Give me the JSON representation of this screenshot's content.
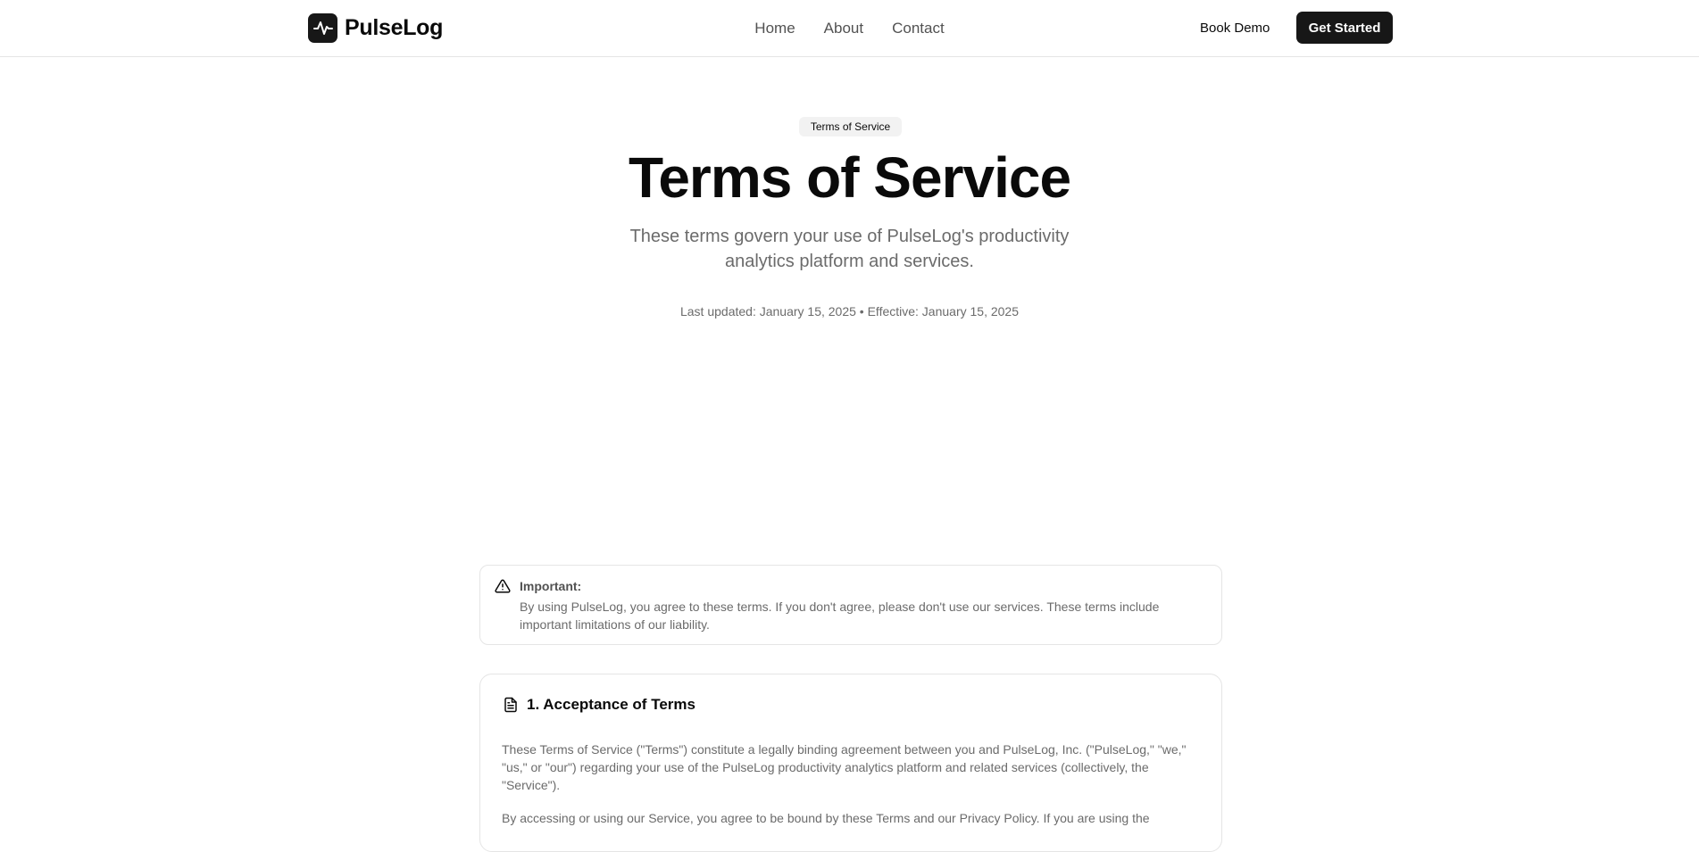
{
  "header": {
    "brand_name": "PulseLog",
    "nav": [
      {
        "label": "Home"
      },
      {
        "label": "About"
      },
      {
        "label": "Contact"
      }
    ],
    "book_demo_label": "Book Demo",
    "get_started_label": "Get Started"
  },
  "hero": {
    "badge": "Terms of Service",
    "title": "Terms of Service",
    "subtitle": "These terms govern your use of PulseLog's productivity analytics platform and services.",
    "meta": "Last updated: January 15, 2025 • Effective: January 15, 2025"
  },
  "alert": {
    "icon": "warning-triangle-icon",
    "title": "Important:",
    "body": "By using PulseLog, you agree to these terms. If you don't agree, please don't use our services. These terms include important limitations of our liability."
  },
  "sections": [
    {
      "icon": "document-icon",
      "title": "1. Acceptance of Terms",
      "paragraphs": [
        "These Terms of Service (\"Terms\") constitute a legally binding agreement between you and PulseLog, Inc. (\"PulseLog,\" \"we,\" \"us,\" or \"our\") regarding your use of the PulseLog productivity analytics platform and related services (collectively, the \"Service\").",
        "By accessing or using our Service, you agree to be bound by these Terms and our Privacy Policy. If you are using the"
      ]
    }
  ],
  "colors": {
    "primary": "#171717",
    "text": "#0a0a0a",
    "muted": "#6b6b6b",
    "border": "#e5e5e5",
    "badge_bg": "#f2f2f2"
  }
}
